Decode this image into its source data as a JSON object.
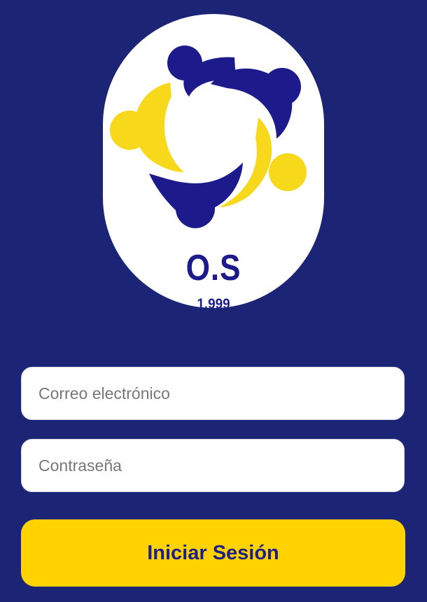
{
  "logo": {
    "mark_text": "O.S",
    "year": "1.999",
    "colors": {
      "badge": "#ffffff",
      "navy": "#1d1a8c",
      "yellow": "#f7d81a"
    }
  },
  "form": {
    "email_placeholder": "Correo electrónico",
    "password_placeholder": "Contraseña",
    "submit_label": "Iniciar Sesión"
  },
  "colors": {
    "background": "#1c2475",
    "button": "#ffd200",
    "button_text": "#1f1f8a"
  }
}
